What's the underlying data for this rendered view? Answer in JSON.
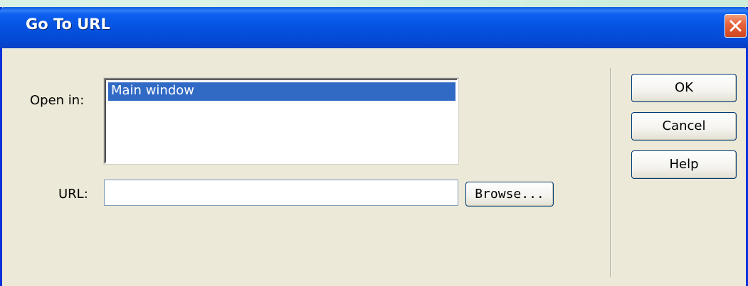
{
  "dialog": {
    "title": "Go To URL",
    "close_icon": "close-icon"
  },
  "form": {
    "open_in_label": "Open in:",
    "open_in_options": [
      "Main window"
    ],
    "selected_option": "Main window",
    "url_label": "URL:",
    "url_value": "",
    "browse_label": "Browse..."
  },
  "buttons": {
    "ok": "OK",
    "cancel": "Cancel",
    "help": "Help"
  },
  "colors": {
    "titlebar": "#0552e0",
    "dialog_bg": "#ece9d8",
    "selection": "#316ac5",
    "close_button": "#d2461e"
  }
}
